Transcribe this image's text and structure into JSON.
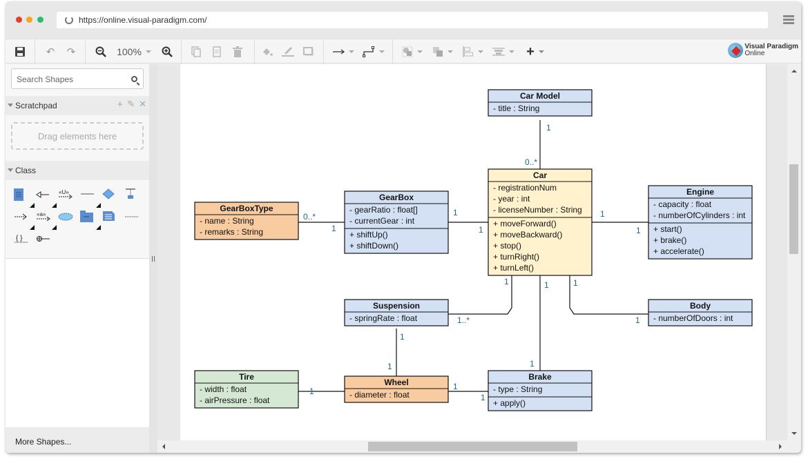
{
  "browser": {
    "url": "https://online.visual-paradigm.com/",
    "traffic_lights": [
      "#e0412c",
      "#f5a623",
      "#2bbd6e"
    ]
  },
  "toolbar": {
    "zoom_level": "100%",
    "buttons": [
      "save",
      "undo",
      "redo",
      "zoom-out",
      "zoom-level",
      "zoom-in",
      "copy",
      "paste",
      "delete",
      "fill-color",
      "line-color",
      "shadow",
      "connector-style",
      "waypoint-style",
      "select",
      "arrange",
      "align",
      "distribute",
      "insert"
    ]
  },
  "logo": {
    "line1": "Visual Paradigm",
    "line2": "Online"
  },
  "sidebar": {
    "search_placeholder": "Search Shapes",
    "scratchpad_label": "Scratchpad",
    "scratchpad_actions": [
      "+",
      "✎",
      "✕"
    ],
    "dropzone_text": "Drag elements here",
    "class_section_label": "Class",
    "more_shapes": "More Shapes..."
  },
  "diagram": {
    "classes": [
      {
        "id": "carmodel",
        "name": "Car Model",
        "color": "#d4e1f5",
        "attributes": [
          "- title : String"
        ],
        "operations": []
      },
      {
        "id": "car",
        "name": "Car",
        "color": "#fff2cc",
        "attributes": [
          "- registrationNum",
          "- year : int",
          "- licenseNumber : String"
        ],
        "operations": [
          "+ moveForward()",
          "+ moveBackward()",
          "+ stop()",
          "+ turnRight()",
          "+ turnLeft()"
        ]
      },
      {
        "id": "gearboxtype",
        "name": "GearBoxType",
        "color": "#f8cba0",
        "attributes": [
          "- name : String",
          "- remarks : String"
        ],
        "operations": []
      },
      {
        "id": "gearbox",
        "name": "GearBox",
        "color": "#d4e1f5",
        "attributes": [
          "- gearRatio : float[]",
          "- currentGear : int"
        ],
        "operations": [
          "+ shiftUp()",
          "+ shiftDown()"
        ]
      },
      {
        "id": "engine",
        "name": "Engine",
        "color": "#d4e1f5",
        "attributes": [
          "- capacity : float",
          "- numberOfCylinders : int"
        ],
        "operations": [
          "+ start()",
          "+ brake()",
          "+ accelerate()"
        ]
      },
      {
        "id": "suspension",
        "name": "Suspension",
        "color": "#d4e1f5",
        "attributes": [
          "- springRate : float"
        ],
        "operations": []
      },
      {
        "id": "body",
        "name": "Body",
        "color": "#d4e1f5",
        "attributes": [
          "- numberOfDoors : int"
        ],
        "operations": []
      },
      {
        "id": "tire",
        "name": "Tire",
        "color": "#d5e8d4",
        "attributes": [
          "- width : float",
          "- airPressure : float"
        ],
        "operations": []
      },
      {
        "id": "wheel",
        "name": "Wheel",
        "color": "#f8cba0",
        "attributes": [
          "- diameter : float"
        ],
        "operations": []
      },
      {
        "id": "brake",
        "name": "Brake",
        "color": "#d4e1f5",
        "attributes": [
          "- type : String"
        ],
        "operations": [
          "+ apply()"
        ]
      }
    ],
    "associations": [
      {
        "from": "carmodel",
        "to": "car",
        "from_mult": "1",
        "to_mult": "0..*"
      },
      {
        "from": "gearboxtype",
        "to": "gearbox",
        "from_mult": "0..*",
        "to_mult": "1"
      },
      {
        "from": "gearbox",
        "to": "car",
        "from_mult": "1",
        "to_mult": "1"
      },
      {
        "from": "car",
        "to": "engine",
        "from_mult": "1",
        "to_mult": "1"
      },
      {
        "from": "car",
        "to": "suspension",
        "from_mult": "1",
        "to_mult": "1..*"
      },
      {
        "from": "car",
        "to": "brake",
        "from_mult": "1",
        "to_mult": "1"
      },
      {
        "from": "car",
        "to": "body",
        "from_mult": "1",
        "to_mult": "1"
      },
      {
        "from": "suspension",
        "to": "wheel",
        "from_mult": "1",
        "to_mult": "1"
      },
      {
        "from": "tire",
        "to": "wheel",
        "from_mult": "",
        "to_mult": "1"
      },
      {
        "from": "wheel",
        "to": "brake",
        "from_mult": "1",
        "to_mult": "1"
      }
    ]
  }
}
